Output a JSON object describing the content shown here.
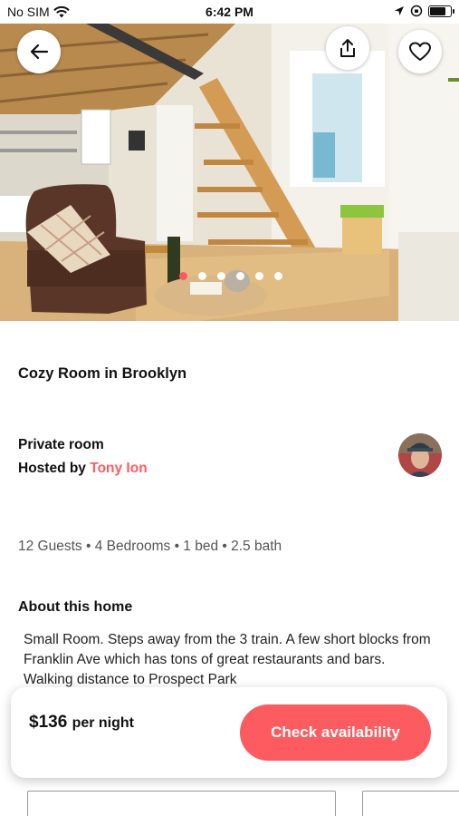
{
  "status_bar": {
    "carrier": "No SIM",
    "time": "6:42 PM"
  },
  "hero": {
    "photo_description_icon": "listing-photo",
    "page_count": 6,
    "active_page": 1
  },
  "actions": {
    "back_icon": "arrow-left-icon",
    "share_icon": "share-icon",
    "favorite_icon": "heart-icon"
  },
  "listing": {
    "title": "Cozy Room in Brooklyn",
    "room_type": "Private room",
    "hosted_by_label": "Hosted by",
    "host_name": "Tony Ion",
    "specs": "12 Guests • 4 Bedrooms • 1 bed • 2.5 bath",
    "about_title": "About this home",
    "about_text": "Small Room. Steps away from the 3 train. A few short blocks from Franklin Ave which has tons of great restaurants and bars. Walking distance to Prospect Park"
  },
  "booking": {
    "price": "$136",
    "per_night": "per night",
    "cta_label": "Check availability"
  },
  "colors": {
    "brand": "#ff5a5f",
    "cta": "#fc5c60"
  }
}
